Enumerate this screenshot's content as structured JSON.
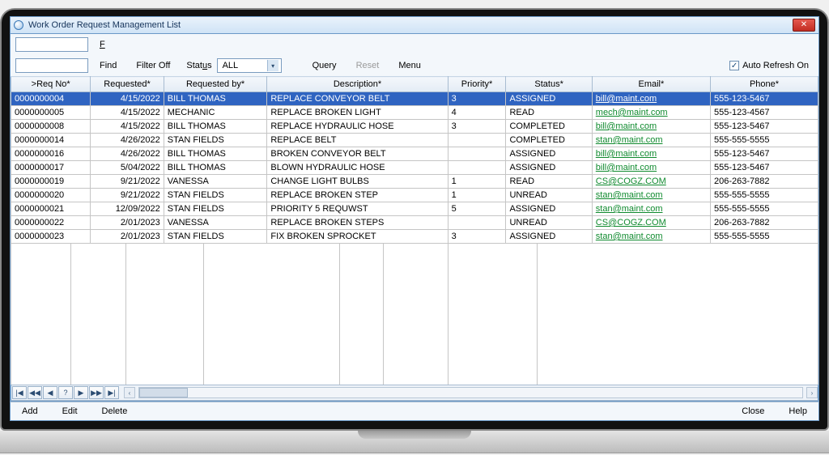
{
  "window": {
    "title": "Work Order Request Management List"
  },
  "toolbar": {
    "find": "Find",
    "filter_off": "Filter Off",
    "status_label": "Status",
    "status_value": "ALL",
    "query": "Query",
    "reset": "Reset",
    "menu": "Menu",
    "auto_refresh": "Auto Refresh On"
  },
  "columns": {
    "req_no": ">Req No*",
    "requested": "Requested*",
    "requested_by": "Requested by*",
    "description": "Description*",
    "priority": "Priority*",
    "status": "Status*",
    "email": "Email*",
    "phone": "Phone*"
  },
  "rows": [
    {
      "req_no": "0000000004",
      "requested": "4/15/2022",
      "requested_by": "BILL THOMAS",
      "description": "REPLACE CONVEYOR BELT",
      "priority": "3",
      "status": "ASSIGNED",
      "email": "bill@maint.com",
      "phone": "555-123-5467",
      "selected": true
    },
    {
      "req_no": "0000000005",
      "requested": "4/15/2022",
      "requested_by": "MECHANIC",
      "description": "REPLACE BROKEN LIGHT",
      "priority": "4",
      "status": "READ",
      "email": "mech@maint.com",
      "phone": "555-123-4567"
    },
    {
      "req_no": "0000000008",
      "requested": "4/15/2022",
      "requested_by": "BILL THOMAS",
      "description": "REPLACE HYDRAULIC HOSE",
      "priority": "3",
      "status": "COMPLETED",
      "email": "bill@maint.com",
      "phone": "555-123-5467"
    },
    {
      "req_no": "0000000014",
      "requested": "4/26/2022",
      "requested_by": "STAN FIELDS",
      "description": "REPLACE BELT",
      "priority": "",
      "status": "COMPLETED",
      "email": "stan@maint.com",
      "phone": "555-555-5555"
    },
    {
      "req_no": "0000000016",
      "requested": "4/26/2022",
      "requested_by": "BILL THOMAS",
      "description": "BROKEN CONVEYOR BELT",
      "priority": "",
      "status": "ASSIGNED",
      "email": "bill@maint.com",
      "phone": "555-123-5467"
    },
    {
      "req_no": "0000000017",
      "requested": "5/04/2022",
      "requested_by": "BILL THOMAS",
      "description": "BLOWN HYDRAULIC HOSE",
      "priority": "",
      "status": "ASSIGNED",
      "email": "bill@maint.com",
      "phone": "555-123-5467"
    },
    {
      "req_no": "0000000019",
      "requested": "9/21/2022",
      "requested_by": "VANESSA",
      "description": "CHANGE LIGHT BULBS",
      "priority": "1",
      "status": "READ",
      "email": "CS@COGZ.COM",
      "phone": "206-263-7882"
    },
    {
      "req_no": "0000000020",
      "requested": "9/21/2022",
      "requested_by": "STAN FIELDS",
      "description": "REPLACE BROKEN STEP",
      "priority": "1",
      "status": "UNREAD",
      "email": "stan@maint.com",
      "phone": "555-555-5555"
    },
    {
      "req_no": "0000000021",
      "requested": "12/09/2022",
      "requested_by": "STAN FIELDS",
      "description": "PRIORITY 5 REQUWST",
      "priority": "5",
      "status": "ASSIGNED",
      "email": "stan@maint.com",
      "phone": "555-555-5555"
    },
    {
      "req_no": "0000000022",
      "requested": "2/01/2023",
      "requested_by": "VANESSA",
      "description": "REPLACE BROKEN STEPS",
      "priority": "",
      "status": "UNREAD",
      "email": "CS@COGZ.COM",
      "phone": "206-263-7882"
    },
    {
      "req_no": "0000000023",
      "requested": "2/01/2023",
      "requested_by": "STAN FIELDS",
      "description": "FIX BROKEN SPROCKET",
      "priority": "3",
      "status": "ASSIGNED",
      "email": "stan@maint.com",
      "phone": "555-555-5555"
    }
  ],
  "nav": {
    "first": "|◀",
    "prev_set": "◀◀",
    "prev": "◀",
    "query": "?",
    "next": "▶",
    "next_set": "▶▶",
    "last": "▶|",
    "scroll_left": "‹",
    "scroll_right": "›"
  },
  "bottom": {
    "add": "Add",
    "edit": "Edit",
    "delete": "Delete",
    "close": "Close",
    "help": "Help"
  }
}
